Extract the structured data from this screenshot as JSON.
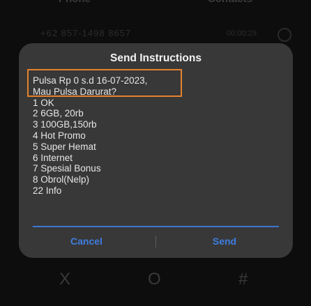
{
  "background": {
    "tabs": [
      "Phone",
      "Contacts"
    ],
    "row_number": "+62 857-1498 8657",
    "row_time": "00:00:29",
    "keypad": [
      "X",
      "O",
      "#"
    ]
  },
  "dialog": {
    "title": "Send Instructions",
    "message_lines": [
      "Pulsa Rp 0 s.d 16-07-2023,",
      "Mau Pulsa Darurat?",
      "1 OK",
      "2 6GB, 20rb",
      "3 100GB,150rb",
      "4 Hot Promo",
      "5 Super Hemat",
      "6 Internet",
      "7 Spesial Bonus",
      "8 Obrol(Nelp)",
      "22 Info"
    ],
    "reply_value": "",
    "cancel_label": "Cancel",
    "send_label": "Send"
  },
  "colors": {
    "accent": "#3f7de0",
    "highlight_box": "#e4822c",
    "dialog_bg": "#383838"
  }
}
